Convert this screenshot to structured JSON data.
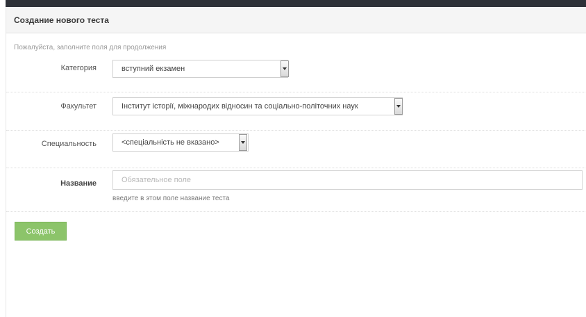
{
  "panel": {
    "title": "Создание нового теста",
    "hint": "Пожалуйста, заполните поля для продолжения"
  },
  "form": {
    "category": {
      "label": "Категория",
      "value": "вступний екзамен"
    },
    "faculty": {
      "label": "Факультет",
      "value": "Інститут історії, міжнародих відносин та соціально-політочних наук"
    },
    "speciality": {
      "label": "Специальность",
      "value": "<спеціальність не вказано>"
    },
    "name": {
      "label": "Название",
      "placeholder": "Обязательное поле",
      "value": "",
      "help": "введите в этом поле название теста"
    }
  },
  "actions": {
    "create_label": "Создать"
  },
  "colors": {
    "accent_button": "#8cc46a",
    "header_bar": "#2e3138"
  },
  "icons": {
    "select_arrow": "chevron-down-icon"
  }
}
